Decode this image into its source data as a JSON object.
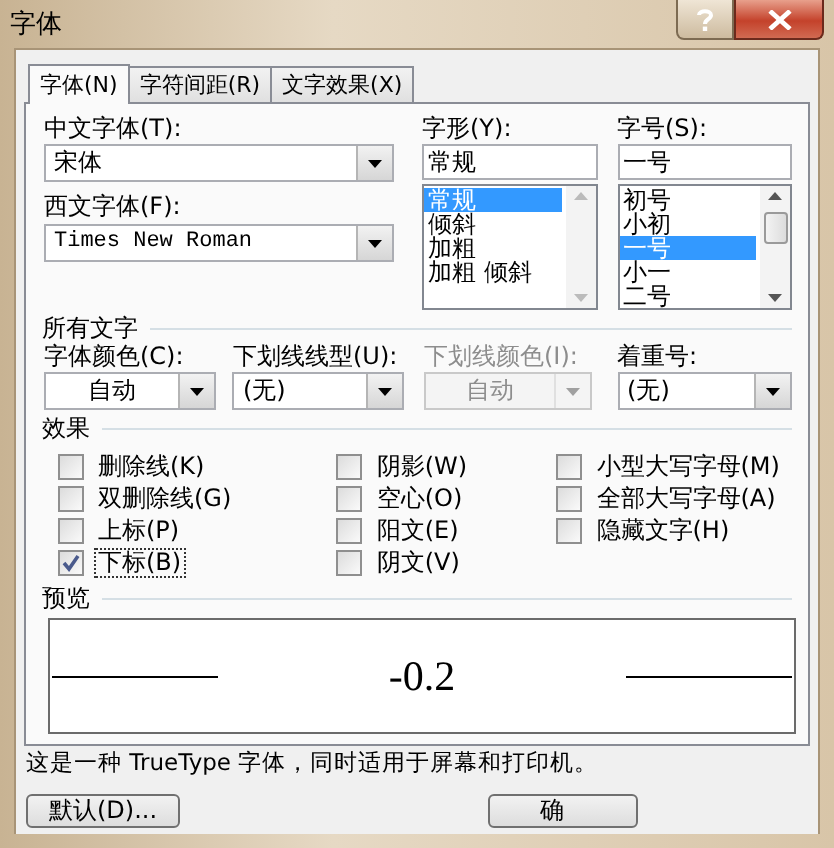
{
  "window": {
    "title": "字体"
  },
  "tabs": [
    {
      "label": "字体(N)",
      "selected": true
    },
    {
      "label": "字符间距(R)",
      "selected": false
    },
    {
      "label": "文字效果(X)",
      "selected": false
    }
  ],
  "chinese_font": {
    "label": "中文字体(T):",
    "value": "宋体"
  },
  "western_font": {
    "label": "西文字体(F):",
    "value": "Times New Roman"
  },
  "font_style": {
    "label": "字形(Y):",
    "value": "常规",
    "options": [
      {
        "text": "常规",
        "selected": true
      },
      {
        "text": "倾斜",
        "selected": false
      },
      {
        "text": "加粗",
        "selected": false
      },
      {
        "text": "加粗 倾斜",
        "selected": false
      }
    ]
  },
  "font_size": {
    "label": "字号(S):",
    "value": "一号",
    "options": [
      {
        "text": "初号",
        "selected": false
      },
      {
        "text": "小初",
        "selected": false
      },
      {
        "text": "一号",
        "selected": true
      },
      {
        "text": "小一",
        "selected": false
      },
      {
        "text": "二号",
        "selected": false
      }
    ]
  },
  "all_text": {
    "title": "所有文字",
    "combos": [
      {
        "kind": "color",
        "label": "字体颜色(C):",
        "value": "自动",
        "disabled": false
      },
      {
        "kind": "style",
        "label": "下划线线型(U):",
        "value": "(无)",
        "disabled": false
      },
      {
        "kind": "color",
        "label": "下划线颜色(I):",
        "value": "自动",
        "disabled": true
      },
      {
        "kind": "style",
        "label": "着重号:",
        "value": "(无)",
        "disabled": false
      }
    ]
  },
  "effects": {
    "title": "效果",
    "columns": [
      {
        "items": [
          {
            "label": "删除线(K)",
            "checked": false,
            "focused": false
          },
          {
            "label": "双删除线(G)",
            "checked": false,
            "focused": false
          },
          {
            "label": "上标(P)",
            "checked": false,
            "focused": false
          },
          {
            "label": "下标(B)",
            "checked": true,
            "focused": true
          }
        ]
      },
      {
        "items": [
          {
            "label": "阴影(W)",
            "checked": false,
            "focused": false
          },
          {
            "label": "空心(O)",
            "checked": false,
            "focused": false
          },
          {
            "label": "阳文(E)",
            "checked": false,
            "focused": false
          },
          {
            "label": "阴文(V)",
            "checked": false,
            "focused": false
          }
        ]
      },
      {
        "items": [
          {
            "label": "小型大写字母(M)",
            "checked": false,
            "focused": false
          },
          {
            "label": "全部大写字母(A)",
            "checked": false,
            "focused": false
          },
          {
            "label": "隐藏文字(H)",
            "checked": false,
            "focused": false
          }
        ]
      }
    ]
  },
  "preview": {
    "title": "预览",
    "sample": "-0.2"
  },
  "note": "这是一种 TrueType 字体，同时适用于屏幕和打印机。",
  "buttons": [
    {
      "label": "默认(D)..."
    },
    {
      "label": "确"
    }
  ]
}
